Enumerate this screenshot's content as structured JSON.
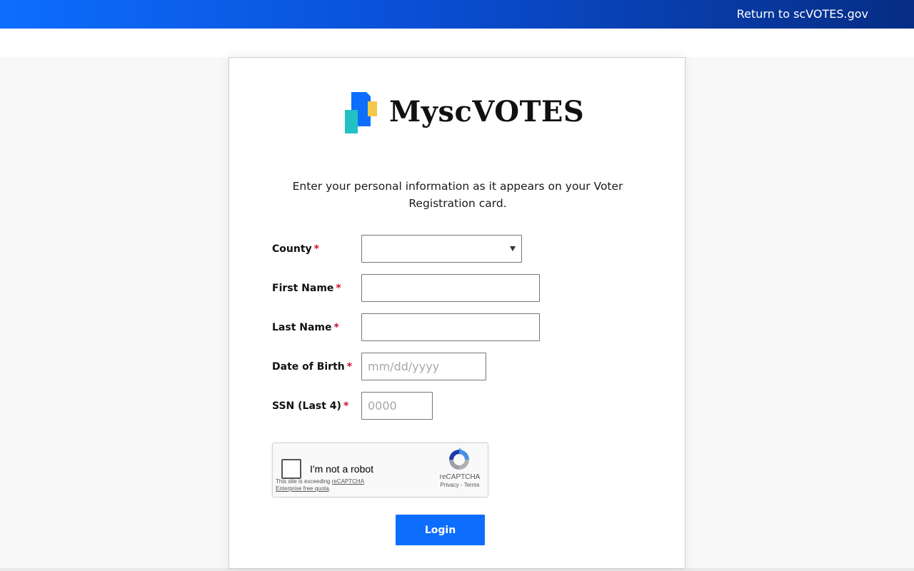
{
  "header": {
    "return_link": "Return to scVOTES.gov",
    "gradient_colors": [
      "#0d6efd",
      "#062d84"
    ]
  },
  "logo": {
    "text": "MyscVOTES",
    "mark_colors": [
      "#0d6efd",
      "#f2c94c",
      "#22c1c3"
    ]
  },
  "form": {
    "intro": "Enter your personal information as it appears on your Voter Registration card.",
    "required_marker": "*",
    "required_color": "#c8102e",
    "fields": {
      "county": {
        "label": "County",
        "value": ""
      },
      "first_name": {
        "label": "First Name",
        "value": ""
      },
      "last_name": {
        "label": "Last Name",
        "value": ""
      },
      "dob": {
        "label": "Date of Birth",
        "value": "",
        "placeholder": "mm/dd/yyyy"
      },
      "ssn": {
        "label": "SSN (Last 4)",
        "value": "",
        "placeholder": "0000"
      }
    },
    "captcha": {
      "label": "I'm not a robot",
      "warning_prefix": "This site is exceeding ",
      "warning_link": "reCAPTCHA Enterprise free quota",
      "warning_suffix": ".",
      "brand": "reCAPTCHA",
      "privacy": "Privacy",
      "separator": " - ",
      "terms": "Terms",
      "checked": false
    },
    "login_label": "Login",
    "accent_color": "#0d6efd"
  }
}
